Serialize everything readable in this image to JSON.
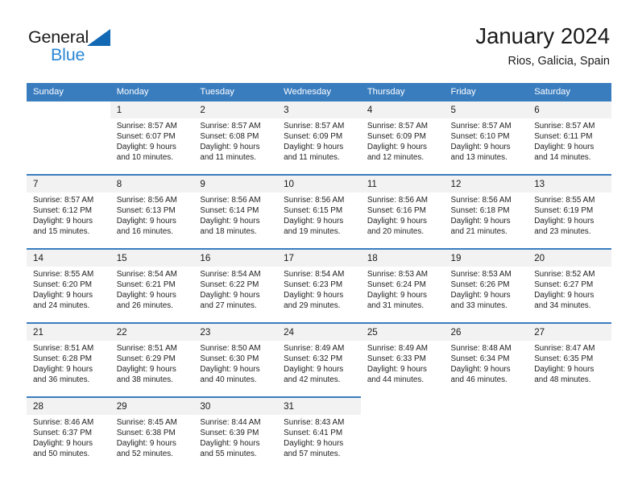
{
  "brand": {
    "name_top": "General",
    "name_bottom": "Blue",
    "accent_color": "#2b87d4",
    "triangle_color": "#1268b3"
  },
  "header": {
    "title": "January 2024",
    "subtitle": "Rios, Galicia, Spain"
  },
  "theme": {
    "header_row_bg": "#3a7dbf",
    "daynum_bg": "#f2f2f2",
    "separator": "#3a7dbf",
    "text": "#222222"
  },
  "weekday_headers": [
    "Sunday",
    "Monday",
    "Tuesday",
    "Wednesday",
    "Thursday",
    "Friday",
    "Saturday"
  ],
  "weeks": [
    {
      "days": [
        {
          "num": "",
          "lines": []
        },
        {
          "num": "1",
          "lines": [
            "Sunrise: 8:57 AM",
            "Sunset: 6:07 PM",
            "Daylight: 9 hours",
            "and 10 minutes."
          ]
        },
        {
          "num": "2",
          "lines": [
            "Sunrise: 8:57 AM",
            "Sunset: 6:08 PM",
            "Daylight: 9 hours",
            "and 11 minutes."
          ]
        },
        {
          "num": "3",
          "lines": [
            "Sunrise: 8:57 AM",
            "Sunset: 6:09 PM",
            "Daylight: 9 hours",
            "and 11 minutes."
          ]
        },
        {
          "num": "4",
          "lines": [
            "Sunrise: 8:57 AM",
            "Sunset: 6:09 PM",
            "Daylight: 9 hours",
            "and 12 minutes."
          ]
        },
        {
          "num": "5",
          "lines": [
            "Sunrise: 8:57 AM",
            "Sunset: 6:10 PM",
            "Daylight: 9 hours",
            "and 13 minutes."
          ]
        },
        {
          "num": "6",
          "lines": [
            "Sunrise: 8:57 AM",
            "Sunset: 6:11 PM",
            "Daylight: 9 hours",
            "and 14 minutes."
          ]
        }
      ]
    },
    {
      "days": [
        {
          "num": "7",
          "lines": [
            "Sunrise: 8:57 AM",
            "Sunset: 6:12 PM",
            "Daylight: 9 hours",
            "and 15 minutes."
          ]
        },
        {
          "num": "8",
          "lines": [
            "Sunrise: 8:56 AM",
            "Sunset: 6:13 PM",
            "Daylight: 9 hours",
            "and 16 minutes."
          ]
        },
        {
          "num": "9",
          "lines": [
            "Sunrise: 8:56 AM",
            "Sunset: 6:14 PM",
            "Daylight: 9 hours",
            "and 18 minutes."
          ]
        },
        {
          "num": "10",
          "lines": [
            "Sunrise: 8:56 AM",
            "Sunset: 6:15 PM",
            "Daylight: 9 hours",
            "and 19 minutes."
          ]
        },
        {
          "num": "11",
          "lines": [
            "Sunrise: 8:56 AM",
            "Sunset: 6:16 PM",
            "Daylight: 9 hours",
            "and 20 minutes."
          ]
        },
        {
          "num": "12",
          "lines": [
            "Sunrise: 8:56 AM",
            "Sunset: 6:18 PM",
            "Daylight: 9 hours",
            "and 21 minutes."
          ]
        },
        {
          "num": "13",
          "lines": [
            "Sunrise: 8:55 AM",
            "Sunset: 6:19 PM",
            "Daylight: 9 hours",
            "and 23 minutes."
          ]
        }
      ]
    },
    {
      "days": [
        {
          "num": "14",
          "lines": [
            "Sunrise: 8:55 AM",
            "Sunset: 6:20 PM",
            "Daylight: 9 hours",
            "and 24 minutes."
          ]
        },
        {
          "num": "15",
          "lines": [
            "Sunrise: 8:54 AM",
            "Sunset: 6:21 PM",
            "Daylight: 9 hours",
            "and 26 minutes."
          ]
        },
        {
          "num": "16",
          "lines": [
            "Sunrise: 8:54 AM",
            "Sunset: 6:22 PM",
            "Daylight: 9 hours",
            "and 27 minutes."
          ]
        },
        {
          "num": "17",
          "lines": [
            "Sunrise: 8:54 AM",
            "Sunset: 6:23 PM",
            "Daylight: 9 hours",
            "and 29 minutes."
          ]
        },
        {
          "num": "18",
          "lines": [
            "Sunrise: 8:53 AM",
            "Sunset: 6:24 PM",
            "Daylight: 9 hours",
            "and 31 minutes."
          ]
        },
        {
          "num": "19",
          "lines": [
            "Sunrise: 8:53 AM",
            "Sunset: 6:26 PM",
            "Daylight: 9 hours",
            "and 33 minutes."
          ]
        },
        {
          "num": "20",
          "lines": [
            "Sunrise: 8:52 AM",
            "Sunset: 6:27 PM",
            "Daylight: 9 hours",
            "and 34 minutes."
          ]
        }
      ]
    },
    {
      "days": [
        {
          "num": "21",
          "lines": [
            "Sunrise: 8:51 AM",
            "Sunset: 6:28 PM",
            "Daylight: 9 hours",
            "and 36 minutes."
          ]
        },
        {
          "num": "22",
          "lines": [
            "Sunrise: 8:51 AM",
            "Sunset: 6:29 PM",
            "Daylight: 9 hours",
            "and 38 minutes."
          ]
        },
        {
          "num": "23",
          "lines": [
            "Sunrise: 8:50 AM",
            "Sunset: 6:30 PM",
            "Daylight: 9 hours",
            "and 40 minutes."
          ]
        },
        {
          "num": "24",
          "lines": [
            "Sunrise: 8:49 AM",
            "Sunset: 6:32 PM",
            "Daylight: 9 hours",
            "and 42 minutes."
          ]
        },
        {
          "num": "25",
          "lines": [
            "Sunrise: 8:49 AM",
            "Sunset: 6:33 PM",
            "Daylight: 9 hours",
            "and 44 minutes."
          ]
        },
        {
          "num": "26",
          "lines": [
            "Sunrise: 8:48 AM",
            "Sunset: 6:34 PM",
            "Daylight: 9 hours",
            "and 46 minutes."
          ]
        },
        {
          "num": "27",
          "lines": [
            "Sunrise: 8:47 AM",
            "Sunset: 6:35 PM",
            "Daylight: 9 hours",
            "and 48 minutes."
          ]
        }
      ]
    },
    {
      "days": [
        {
          "num": "28",
          "lines": [
            "Sunrise: 8:46 AM",
            "Sunset: 6:37 PM",
            "Daylight: 9 hours",
            "and 50 minutes."
          ]
        },
        {
          "num": "29",
          "lines": [
            "Sunrise: 8:45 AM",
            "Sunset: 6:38 PM",
            "Daylight: 9 hours",
            "and 52 minutes."
          ]
        },
        {
          "num": "30",
          "lines": [
            "Sunrise: 8:44 AM",
            "Sunset: 6:39 PM",
            "Daylight: 9 hours",
            "and 55 minutes."
          ]
        },
        {
          "num": "31",
          "lines": [
            "Sunrise: 8:43 AM",
            "Sunset: 6:41 PM",
            "Daylight: 9 hours",
            "and 57 minutes."
          ]
        },
        {
          "num": "",
          "lines": []
        },
        {
          "num": "",
          "lines": []
        },
        {
          "num": "",
          "lines": []
        }
      ]
    }
  ]
}
